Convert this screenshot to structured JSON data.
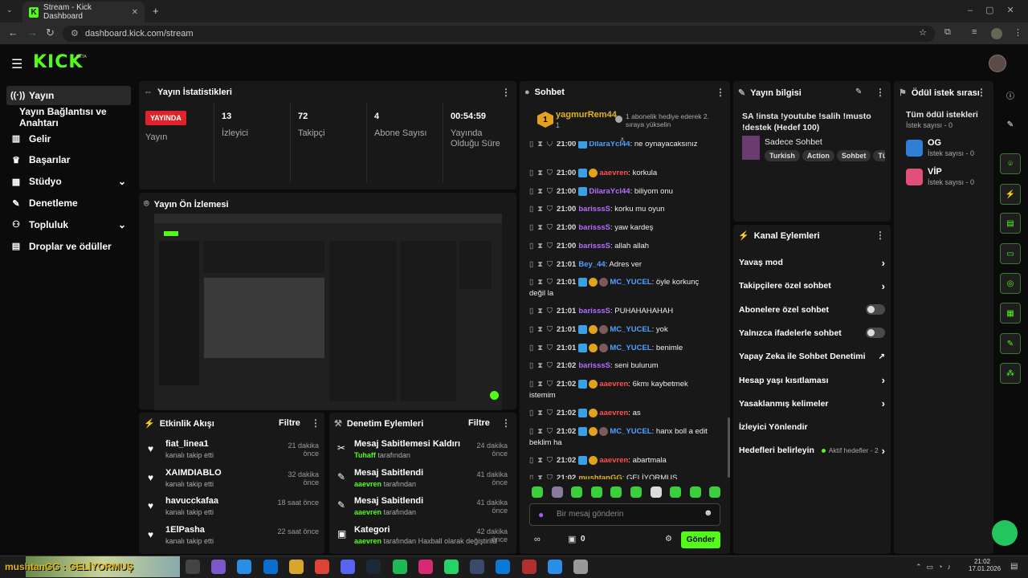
{
  "browser": {
    "tab_title": "Stream - Kick Dashboard",
    "url": "dashboard.kick.com/stream"
  },
  "header": {
    "logo": "KICK",
    "beta": "BETA"
  },
  "sidebar": {
    "items": [
      {
        "icon": "broadcast-icon",
        "label": "Yayın"
      },
      {
        "icon": "",
        "label": "Yayın Bağlantısı ve Anahtarı"
      },
      {
        "icon": "revenue-icon",
        "label": "Gelir"
      },
      {
        "icon": "trophy-icon",
        "label": "Başarılar"
      },
      {
        "icon": "studio-icon",
        "label": "Stüdyo"
      },
      {
        "icon": "wrench-icon",
        "label": "Denetleme"
      },
      {
        "icon": "community-icon",
        "label": "Topluluk"
      },
      {
        "icon": "gift-icon",
        "label": "Droplar ve ödüller"
      }
    ]
  },
  "stats": {
    "title": "Yayın İstatistikleri",
    "live_badge": "YAYINDA",
    "live_label": "Yayın",
    "items": [
      {
        "value": "13",
        "label": "İzleyici"
      },
      {
        "value": "72",
        "label": "Takipçi"
      },
      {
        "value": "4",
        "label": "Abone Sayısı"
      },
      {
        "value": "00:54:59",
        "label": "Yayında Olduğu Süre"
      }
    ]
  },
  "preview": {
    "title": "Yayın Ön İzlemesi"
  },
  "activity": {
    "title": "Etkinlik Akışı",
    "filter": "Filtre",
    "items": [
      {
        "name": "fiat_linea1",
        "sub": "kanalı takip etti",
        "time": "21 dakika önce"
      },
      {
        "name": "XAIMDIABLO",
        "sub": "kanalı takip etti",
        "time": "32 dakika önce"
      },
      {
        "name": "havucckafaa",
        "sub": "kanalı takip etti",
        "time": "18 saat önce"
      },
      {
        "name": "1ElPasha",
        "sub": "kanalı takip etti",
        "time": "22 saat önce"
      }
    ]
  },
  "moderation": {
    "title": "Denetim Eylemleri",
    "filter": "Filtre",
    "items": [
      {
        "title": "Mesaj Sabitlemesi Kaldırıldı",
        "actor": "Tuhaff",
        "rest": " tarafından",
        "time": "24 dakika önce"
      },
      {
        "title": "Mesaj Sabitlendi",
        "actor": "aaevren",
        "rest": " tarafından",
        "time": "41 dakika önce"
      },
      {
        "title": "Mesaj Sabitlendi",
        "actor": "aaevren",
        "rest": " tarafından",
        "time": "41 dakika önce"
      },
      {
        "title": "Kategori",
        "actor": "aaevren",
        "rest": " tarafından Haxball olarak değiştirildi",
        "time": "42 dakika önce"
      }
    ]
  },
  "chat": {
    "title": "Sohbet",
    "gifter": "yagmurRem44",
    "gifter_count": "1",
    "gift_text": "1 abonelik hediye ederek 2. sıraya yükselin",
    "messages": [
      {
        "time": "21:00",
        "user": "DilaraYcl44",
        "cls": "u3",
        "badges": [
          "b-blue"
        ],
        "text": "ne oynayacaksınız"
      },
      {
        "time": "21:00",
        "user": "aaevren",
        "cls": "u1",
        "badges": [
          "b-blue",
          "b-gold"
        ],
        "text": "korkula"
      },
      {
        "time": "21:00",
        "user": "DilaraYcl44",
        "cls": "u2",
        "badges": [
          "b-blue"
        ],
        "text": "biliyom onu"
      },
      {
        "time": "21:00",
        "user": "barisssS",
        "cls": "u2",
        "badges": [],
        "text": "korku mu oyun"
      },
      {
        "time": "21:00",
        "user": "barisssS",
        "cls": "u2",
        "badges": [],
        "text": "yaw kardeş"
      },
      {
        "time": "21:00",
        "user": "barisssS",
        "cls": "u2",
        "badges": [],
        "text": "allah allah"
      },
      {
        "time": "21:01",
        "user": "Bey_44",
        "cls": "u3",
        "badges": [],
        "text": "Adres ver"
      },
      {
        "time": "21:01",
        "user": "MC_YUCEL",
        "cls": "u3",
        "badges": [
          "b-blue",
          "b-gold",
          "b-av"
        ],
        "text": "öyle korkunç değil la"
      },
      {
        "time": "21:01",
        "user": "barisssS",
        "cls": "u2",
        "badges": [],
        "text": "PUHAHAHAHAH"
      },
      {
        "time": "21:01",
        "user": "MC_YUCEL",
        "cls": "u3",
        "badges": [
          "b-blue",
          "b-gold",
          "b-av"
        ],
        "text": "yok"
      },
      {
        "time": "21:01",
        "user": "MC_YUCEL",
        "cls": "u3",
        "badges": [
          "b-blue",
          "b-gold",
          "b-av"
        ],
        "text": "benimle"
      },
      {
        "time": "21:02",
        "user": "barisssS",
        "cls": "u2",
        "badges": [],
        "text": "seni bulurum"
      },
      {
        "time": "21:02",
        "user": "aaevren",
        "cls": "u1",
        "badges": [
          "b-blue",
          "b-gold"
        ],
        "text": "6kmı kaybetmek istemim"
      },
      {
        "time": "21:02",
        "user": "aaevren",
        "cls": "u1",
        "badges": [
          "b-blue",
          "b-gold"
        ],
        "text": "as"
      },
      {
        "time": "21:02",
        "user": "MC_YUCEL",
        "cls": "u3",
        "badges": [
          "b-blue",
          "b-gold",
          "b-av"
        ],
        "text": "hanx boll a edit beklim ha"
      },
      {
        "time": "21:02",
        "user": "aaevren",
        "cls": "u1",
        "badges": [
          "b-blue",
          "b-gold"
        ],
        "text": "abartmala"
      },
      {
        "time": "21:02",
        "user": "mushtanGG",
        "cls": "u4",
        "badges": [],
        "text": "GELİYORMUŞ"
      }
    ],
    "input_placeholder": "Bir mesaj gönderin",
    "points": "0",
    "send_label": "Gönder"
  },
  "stream_info": {
    "title": "Yayın bilgisi",
    "stream_title": "SA !insta !youtube !salih !musto !destek (Hedef 100)",
    "category": "Sadece Sohbet",
    "tags": [
      "Turkish",
      "Action",
      "Sohbet",
      "Tür"
    ]
  },
  "channel_actions": {
    "title": "Kanal Eylemleri",
    "items": [
      {
        "label": "Yavaş mod",
        "ctl": "chevron"
      },
      {
        "label": "Takipçilere özel sohbet",
        "ctl": "chevron"
      },
      {
        "label": "Abonelere özel sohbet",
        "ctl": "toggle"
      },
      {
        "label": "Yalnızca ifadelerle sohbet",
        "ctl": "toggle"
      },
      {
        "label": "Yapay Zeka ile Sohbet Denetimi",
        "ctl": "external"
      },
      {
        "label": "Hesap yaşı kısıtlaması",
        "ctl": "chevron"
      },
      {
        "label": "Yasaklanmış kelimeler",
        "ctl": "chevron"
      },
      {
        "label": "İzleyici Yönlendir",
        "ctl": "none"
      },
      {
        "label": "Hedefleri belirleyin",
        "ctl": "chevron",
        "extra": "Aktif hedefler - 2"
      }
    ]
  },
  "rewards": {
    "title": "Ödül istek sırası",
    "all": "Tüm ödül istekleri",
    "all_sub": "İstek sayısı - 0",
    "items": [
      {
        "name": "OG",
        "sub": "İstek sayısı - 0",
        "color": "#2f7fd6"
      },
      {
        "name": "VİP",
        "sub": "İstek sayısı - 0",
        "color": "#e0507a"
      }
    ]
  },
  "taskbar": {
    "overlay_text": "mushtanGG : GELİYORMUŞ",
    "time": "21:02",
    "date": "17.01.2026"
  },
  "colors": {
    "accent": "#53fc18",
    "live": "#e0222d"
  }
}
